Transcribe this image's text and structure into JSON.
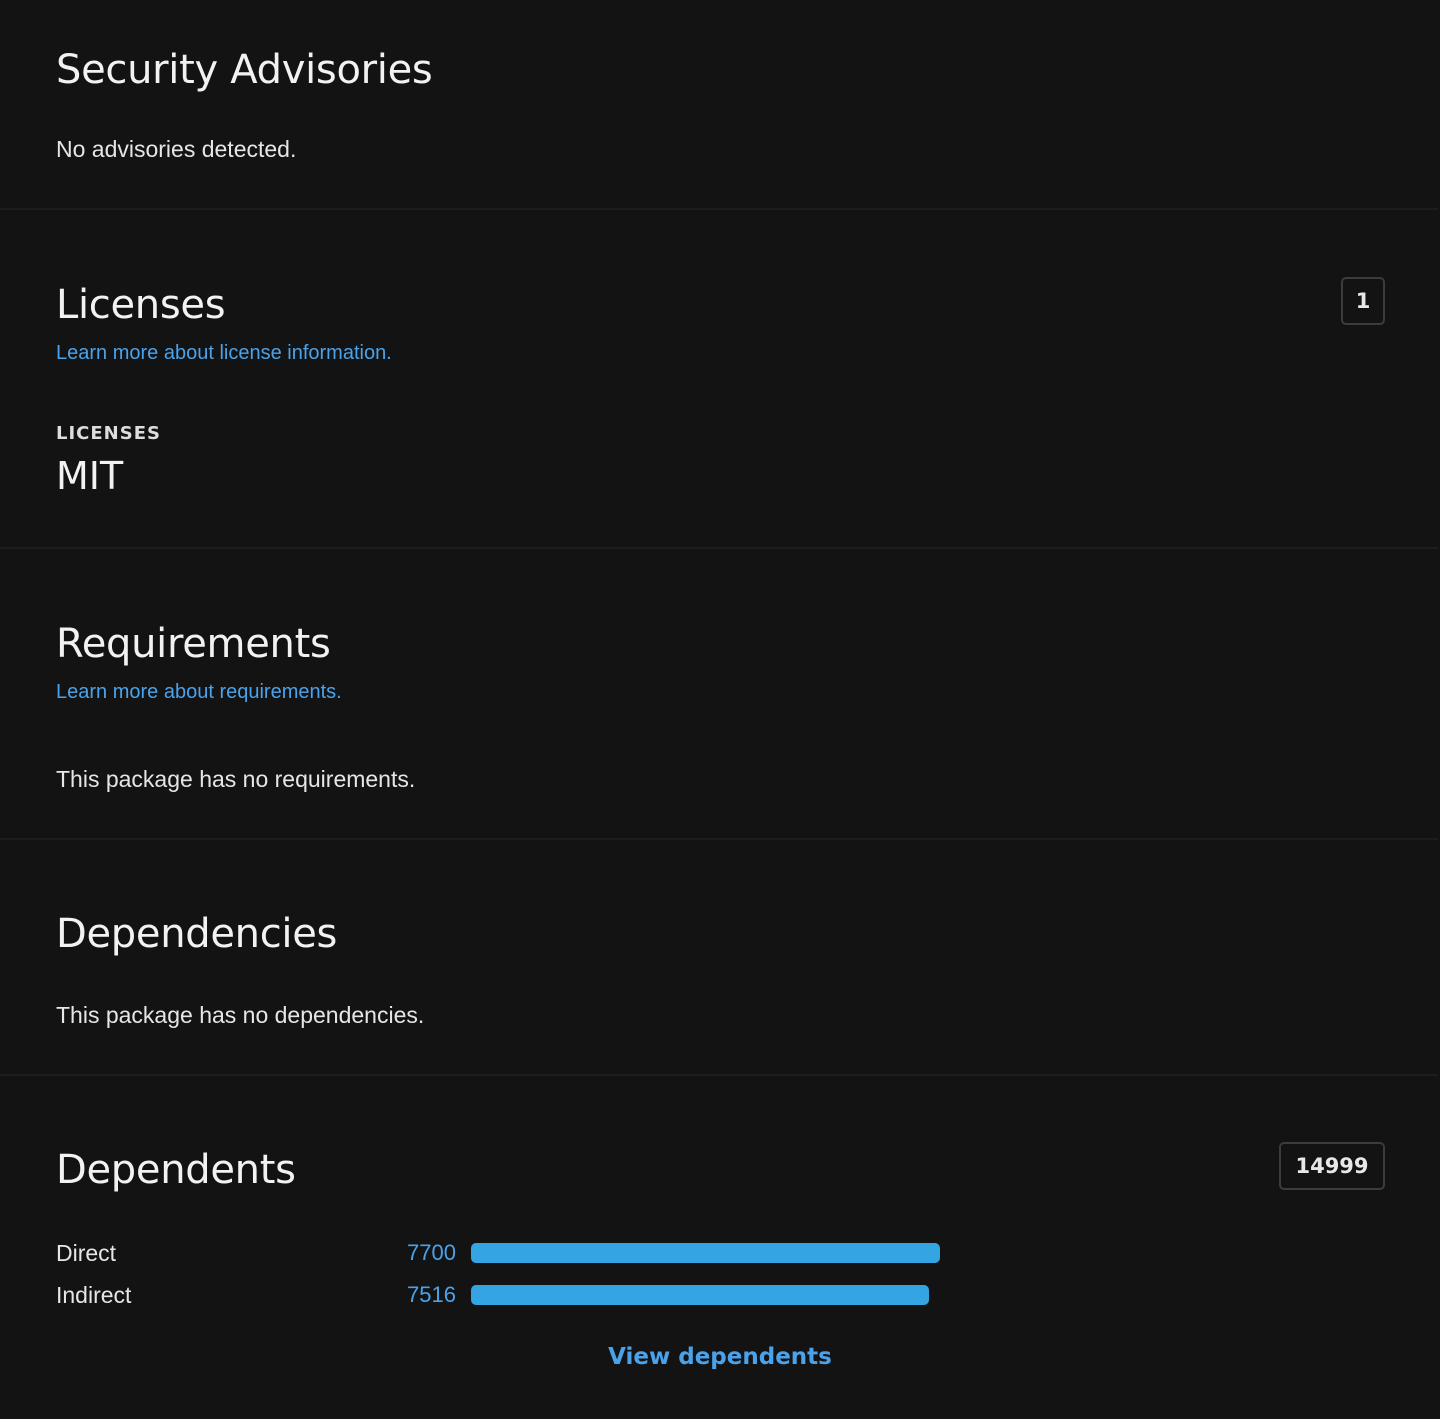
{
  "security": {
    "title": "Security Advisories",
    "message": "No advisories detected."
  },
  "licenses": {
    "title": "Licenses",
    "learn_link": "Learn more about license information.",
    "count": "1",
    "label": "LICENSES",
    "value": "MIT"
  },
  "requirements": {
    "title": "Requirements",
    "learn_link": "Learn more about requirements.",
    "message": "This package has no requirements."
  },
  "dependencies": {
    "title": "Dependencies",
    "message": "This package has no dependencies."
  },
  "dependents": {
    "title": "Dependents",
    "total": "14999",
    "rows": [
      {
        "label": "Direct",
        "count": "7700",
        "fraction": 1.0
      },
      {
        "label": "Indirect",
        "count": "7516",
        "fraction": 0.976
      }
    ],
    "view_link": "View dependents"
  },
  "colors": {
    "background": "#131314",
    "accent": "#4aa3ea",
    "bar": "#34a5e2"
  }
}
